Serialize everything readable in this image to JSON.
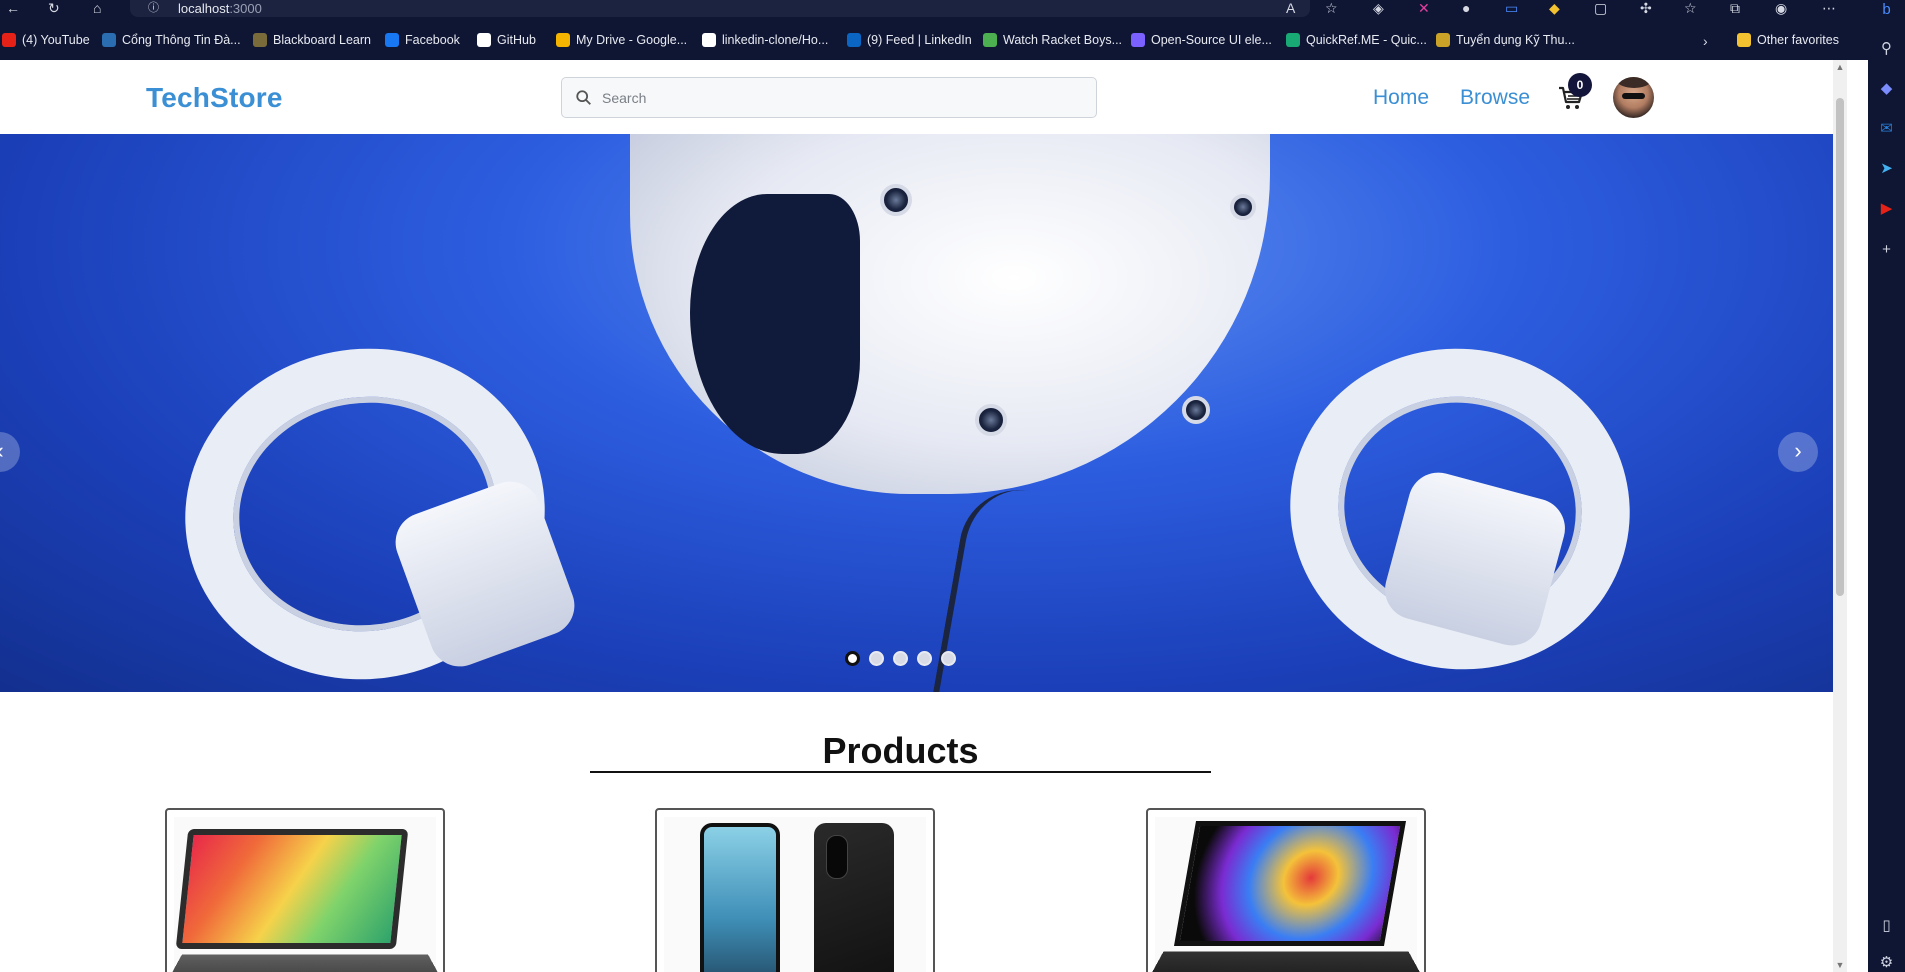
{
  "browser": {
    "url_host": "localhost",
    "url_port": ":3000",
    "bookmarks": [
      {
        "label": "(4) YouTube",
        "color": "#e62117"
      },
      {
        "label": "Cổng Thông Tin Đà...",
        "color": "#2a6db0"
      },
      {
        "label": "Blackboard Learn",
        "color": "#7a6c3a"
      },
      {
        "label": "Facebook",
        "color": "#1877f2"
      },
      {
        "label": "GitHub",
        "color": "#ffffff"
      },
      {
        "label": "My Drive - Google...",
        "color": "#f4b400"
      },
      {
        "label": "linkedin-clone/Ho...",
        "color": "#ffffff"
      },
      {
        "label": "(9) Feed | LinkedIn",
        "color": "#0a66c2"
      },
      {
        "label": "Watch Racket Boys...",
        "color": "#4caf50"
      },
      {
        "label": "Open-Source UI ele...",
        "color": "#7b61ff"
      },
      {
        "label": "QuickRef.ME - Quic...",
        "color": "#19a974"
      },
      {
        "label": "Tuyển dụng Kỹ Thu...",
        "color": "#c9a227"
      }
    ],
    "other_favorites": "Other favorites"
  },
  "header": {
    "logo": "TechStore",
    "search_placeholder": "Search",
    "nav": {
      "home": "Home",
      "browse": "Browse"
    },
    "cart_count": "0"
  },
  "carousel": {
    "slide_count": 5,
    "active_slide": 1,
    "prev_label": "‹",
    "next_label": "›"
  },
  "products": {
    "title": "Products",
    "items": [
      {
        "image": "laptop-colorful-wallpaper"
      },
      {
        "image": "smartphone-front-and-back"
      },
      {
        "image": "laptop-color-smoke-wallpaper"
      }
    ]
  },
  "colors": {
    "brand": "#3b8fd4",
    "badge": "#13163a",
    "chrome": "#0f1633"
  }
}
